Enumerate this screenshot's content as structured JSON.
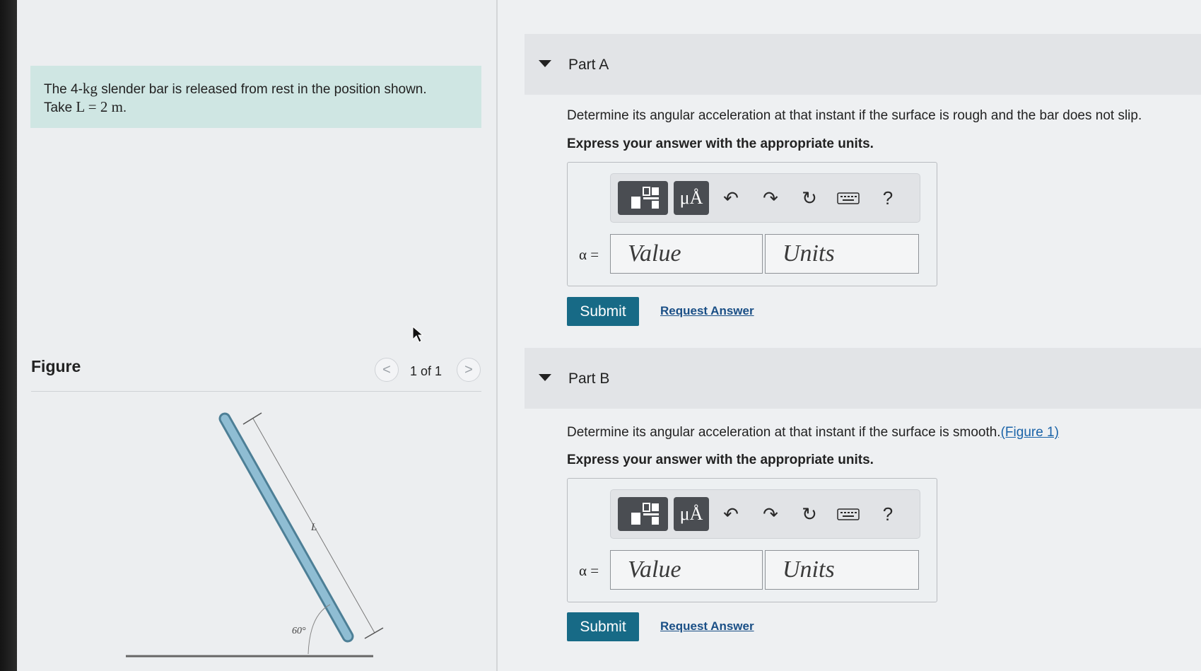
{
  "problem": {
    "text_before": "The 4-",
    "mass_unit": "kg",
    "text_after": " slender bar is released from rest in the position shown.",
    "take_label": "Take ",
    "equation": "L = 2 m",
    "period": "."
  },
  "figure": {
    "title": "Figure",
    "pager_prev": "<",
    "pager_text": "1 of 1",
    "pager_next": ">",
    "length_label": "L",
    "angle_label": "60°"
  },
  "parts": [
    {
      "title": "Part A",
      "question": "Determine its angular acceleration at that instant if the surface is rough and the bar does not slip.",
      "figure_link": "",
      "instruction": "Express your answer with the appropriate units.",
      "variable": "α =",
      "value_placeholder": "Value",
      "units_placeholder": "Units",
      "submit": "Submit",
      "request": "Request Answer"
    },
    {
      "title": "Part B",
      "question": "Determine its angular acceleration at that instant if the surface is smooth.",
      "figure_link": "(Figure 1)",
      "instruction": "Express your answer with the appropriate units.",
      "variable": "α =",
      "value_placeholder": "Value",
      "units_placeholder": "Units",
      "submit": "Submit",
      "request": "Request Answer"
    }
  ],
  "toolbar": {
    "templates_icon": "templates-icon",
    "units_label": "μÅ",
    "undo_icon": "↶",
    "redo_icon": "↷",
    "reset_icon": "↻",
    "keyboard_icon": "keyboard-icon",
    "help": "?"
  },
  "colors": {
    "intro_bg": "#cfe6e3",
    "submit_bg": "#176a86",
    "link": "#1a4f86",
    "bar": "#8fbdd3"
  }
}
